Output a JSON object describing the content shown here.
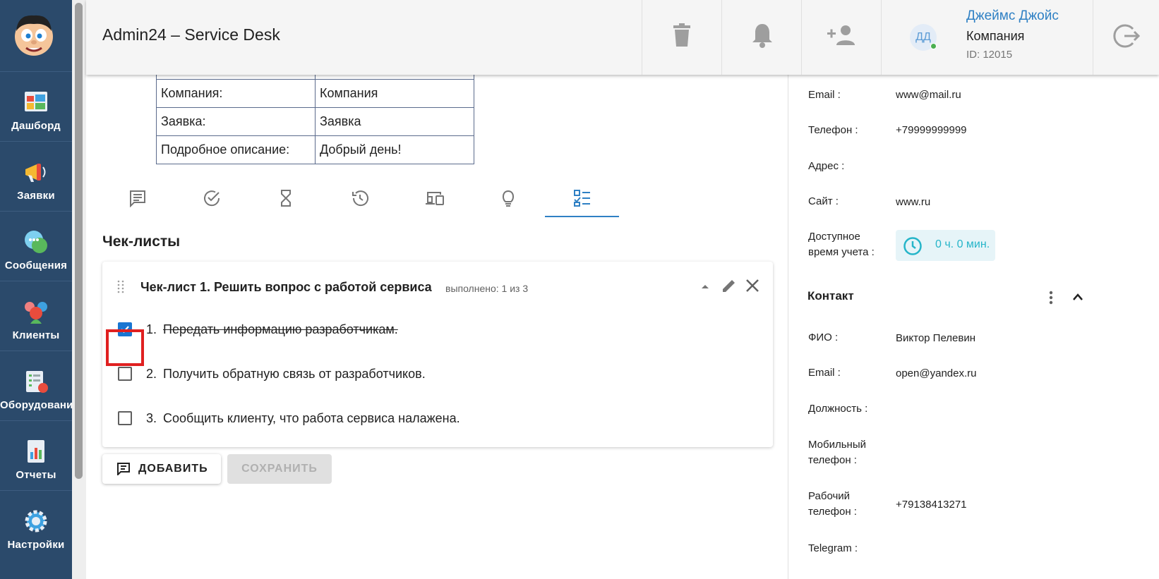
{
  "app": {
    "title": "Admin24 – Service Desk"
  },
  "sidebar": {
    "items": [
      {
        "label": "Дашборд",
        "icon": "dashboard-icon"
      },
      {
        "label": "Заявки",
        "icon": "megaphone-icon"
      },
      {
        "label": "Сообщения",
        "icon": "chat-bubbles-icon"
      },
      {
        "label": "Клиенты",
        "icon": "clients-icon"
      },
      {
        "label": "Оборудование",
        "icon": "equipment-icon"
      },
      {
        "label": "Отчеты",
        "icon": "reports-icon"
      },
      {
        "label": "Настройки",
        "icon": "gear-icon"
      }
    ]
  },
  "header": {
    "user": {
      "name": "Джеймс Джойс",
      "company": "Компания",
      "id": "ID: 12015",
      "initials": "ДД"
    }
  },
  "info_table": [
    {
      "label": "Компания:",
      "value": "Компания"
    },
    {
      "label": "Заявка:",
      "value": "Заявка"
    },
    {
      "label": "Подробное описание:",
      "value": "Добрый день!"
    }
  ],
  "tabs": [
    "comments-icon",
    "check-circle-icon",
    "hourglass-icon",
    "history-icon",
    "devices-icon",
    "lightbulb-icon",
    "checklist-icon"
  ],
  "checklists": {
    "title": "Чек-листы",
    "card": {
      "title": "Чек-лист 1. Решить вопрос с работой сервиса",
      "progress": "выполнено: 1 из 3",
      "items": [
        {
          "num": "1.",
          "text": "Передать информацию разработчикам.",
          "checked": true
        },
        {
          "num": "2.",
          "text": "Получить обратную связь от разработчиков.",
          "checked": false
        },
        {
          "num": "3.",
          "text": "Сообщить клиенту, что работа сервиса налажена.",
          "checked": false
        }
      ]
    },
    "add_label": "ДОБАВИТЬ",
    "save_label": "СОХРАНИТЬ"
  },
  "company_info": {
    "email_label": "Email :",
    "email": "www@mail.ru",
    "phone_label": "Телефон :",
    "phone": "+79999999999",
    "address_label": "Адрес :",
    "site_label": "Сайт :",
    "site": "www.ru",
    "time_label_1": "Доступное",
    "time_label_2": "время учета :",
    "time_value": "0 ч. 0 мин."
  },
  "contact": {
    "title": "Контакт",
    "fio_label": "ФИО :",
    "fio": "Виктор Пелевин",
    "email_label": "Email :",
    "email": "open@yandex.ru",
    "position_label": "Должность :",
    "mobile_label_1": "Мобильный",
    "mobile_label_2": "телефон :",
    "work_label_1": "Рабочий",
    "work_label_2": "телефон :",
    "work_phone": "+79138413271",
    "telegram_label": "Telegram :"
  },
  "colors": {
    "sidebar": "#2b4a6b",
    "accent": "#2f80c4",
    "checked": "#1976d2",
    "highlight": "#e02020",
    "time": "#26b5c9"
  }
}
